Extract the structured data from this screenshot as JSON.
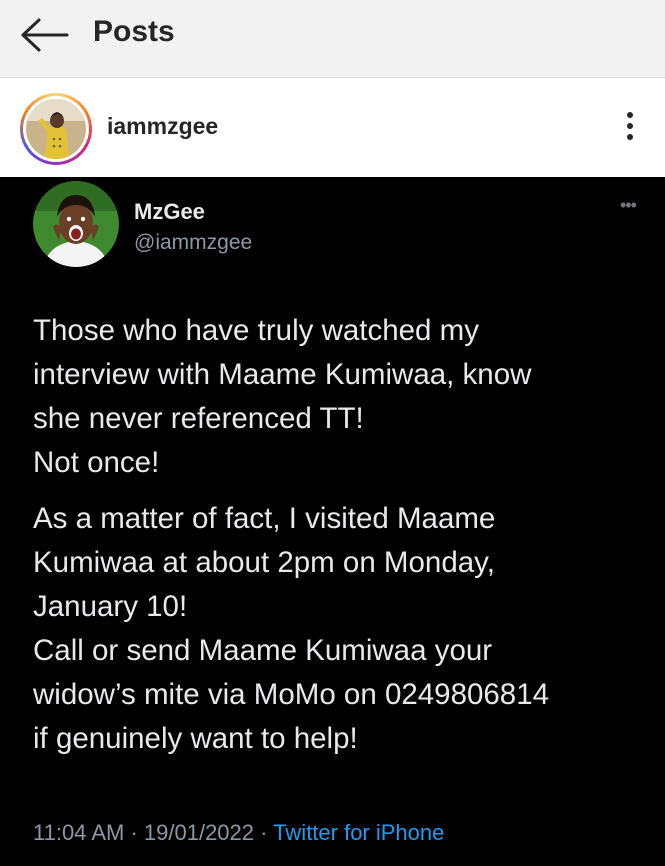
{
  "topbar": {
    "title": "Posts",
    "back_icon": "arrow-left-icon"
  },
  "post_header": {
    "username": "iammzgee",
    "more_icon": "vertical-dots-icon"
  },
  "tweet": {
    "display_name": "MzGee",
    "handle": "@iammzgee",
    "more_icon": "horizontal-dots-icon",
    "lines": [
      "Those who have truly watched my",
      "interview with Maame Kumiwaa, know",
      "she never referenced TT!",
      "Not once!",
      "As a matter of fact, I visited Maame",
      "Kumiwaa at about 2pm on Monday,",
      "January 10!",
      "Call or send Maame Kumiwaa your",
      "widow’s mite via MoMo on 0249806814",
      "if genuinely want to help!"
    ],
    "time": "11:04 AM",
    "date": "19/01/2022",
    "separator": "·",
    "source": "Twitter for iPhone"
  },
  "colors": {
    "tweet_background": "#000000",
    "link_blue": "#1d9bf0",
    "muted_text": "#8b98a5"
  }
}
